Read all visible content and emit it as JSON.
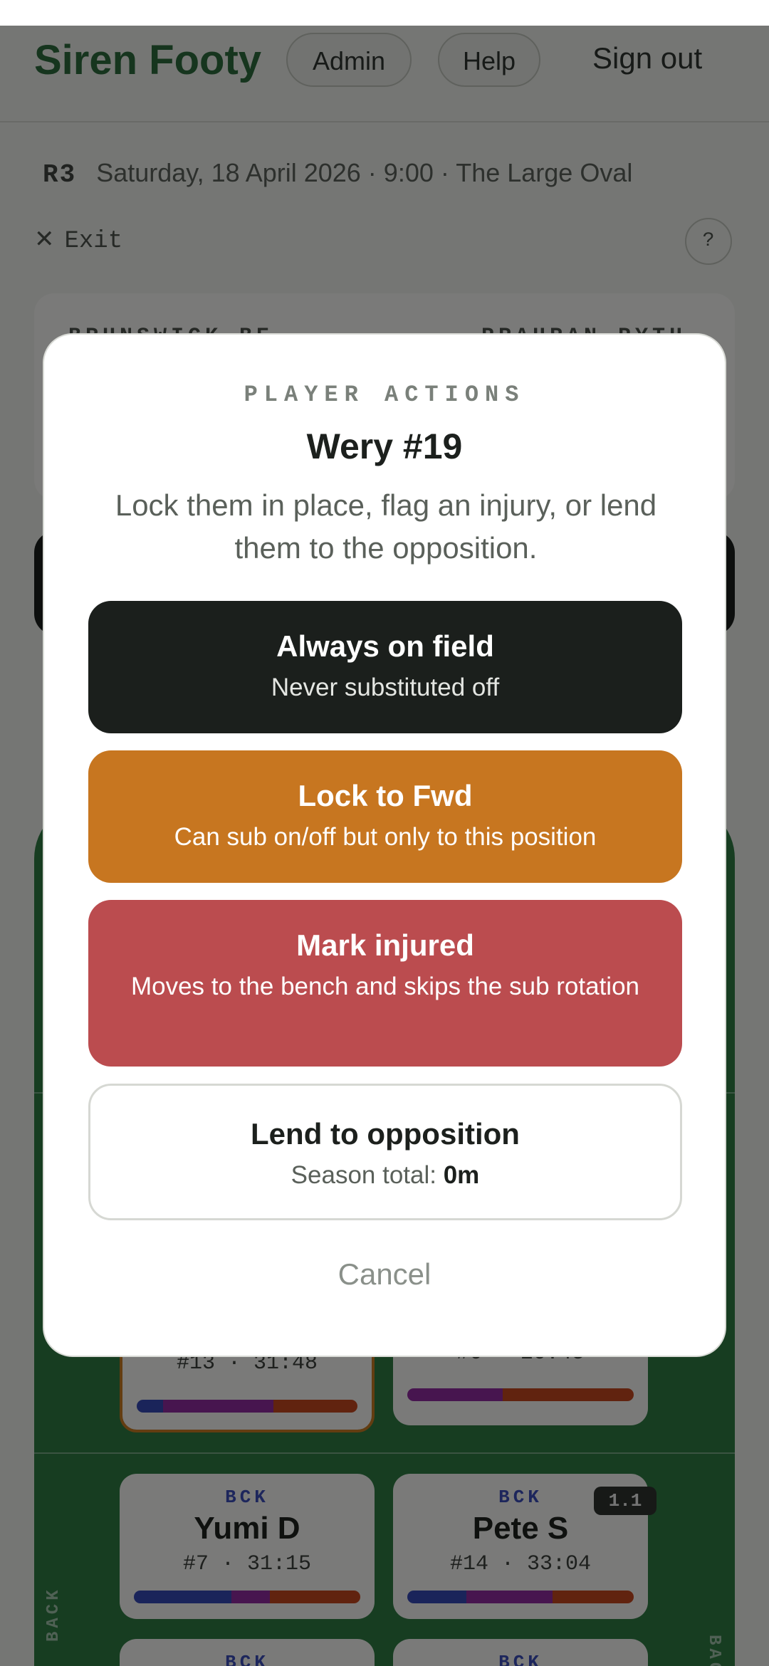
{
  "header": {
    "brand": "Siren Footy",
    "admin_label": "Admin",
    "help_label": "Help",
    "signout_label": "Sign out"
  },
  "game": {
    "round": "R3",
    "info": "Saturday, 18 April 2026 · 9:00  · The Large Oval",
    "exit_label": "Exit",
    "help_symbol": "?",
    "home_team": "BRUNSWICK BE",
    "away_team": "PRAHRAN PYTH"
  },
  "field": {
    "zone_left": "BACK",
    "zone_right": "BACK",
    "badge": "1.1",
    "cards": [
      {
        "pos": "",
        "name": "",
        "stat": "#13 · 31:48",
        "bar": [
          0.12,
          0.5,
          0.38
        ]
      },
      {
        "pos": "",
        "name": "",
        "stat": "#6 · 20:45",
        "bar": [
          0,
          0.42,
          0.58
        ]
      },
      {
        "pos": "BCK",
        "name": "Yumi D",
        "stat": "#7 · 31:15",
        "bar": [
          0.43,
          0.17,
          0.4
        ]
      },
      {
        "pos": "BCK",
        "name": "Pete S",
        "stat": "#14 · 33:04",
        "bar": [
          0.26,
          0.38,
          0.36
        ]
      },
      {
        "pos": "BCK",
        "name": "",
        "stat": "",
        "bar": [
          0,
          0,
          0
        ]
      },
      {
        "pos": "BCK",
        "name": "",
        "stat": "",
        "bar": [
          0,
          0,
          0
        ]
      }
    ]
  },
  "modal": {
    "kicker": "PLAYER ACTIONS",
    "title": "Wery #19",
    "description": "Lock them in place, flag an injury, or lend them to the opposition.",
    "always_title": "Always on field",
    "always_sub": "Never substituted off",
    "lock_title": "Lock to Fwd",
    "lock_sub": "Can sub on/off but only to this position",
    "injured_title": "Mark injured",
    "injured_sub": "Moves to the bench and skips the sub rotation",
    "lend_title": "Lend to opposition",
    "lend_sub_prefix": "Season total:",
    "lend_sub_value": "0m",
    "cancel_label": "Cancel"
  },
  "colors": {
    "brand": "#2c6b3d",
    "field": "#2f7a43",
    "always": "#1b1f1c",
    "lock": "#c77620",
    "injured": "#bb4c4f",
    "bar_back": "#3549b5",
    "bar_mid": "#8f2b9f",
    "bar_fwd": "#c2471e"
  }
}
